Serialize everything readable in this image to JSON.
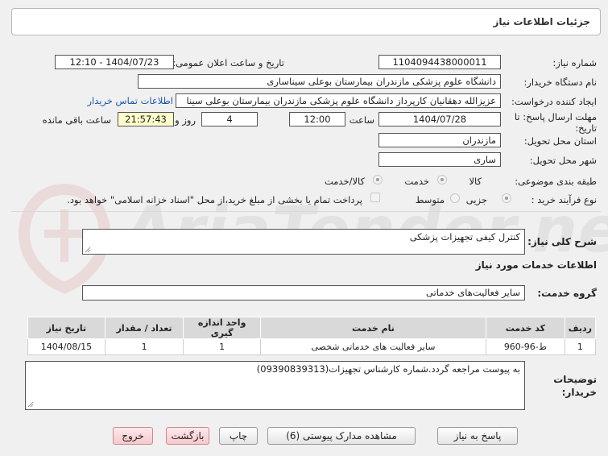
{
  "header": {
    "title": "جزئیات اطلاعات نیاز"
  },
  "fields": {
    "need_number_label": "شماره نیاز:",
    "need_number": "1104094438000011",
    "announce_label": "تاریخ و ساعت اعلان عمومی:",
    "announce_value": "1404/07/23 - 12:10",
    "buyer_org_label": "نام دستگاه خریدار:",
    "buyer_org": "دانشگاه علوم پزشکی مازندران بیمارستان بوعلی سیناساری",
    "requester_label": "ایجاد کننده درخواست:",
    "requester": "عزیزالله دهقانیان کارپرداز دانشگاه علوم پزشکی مازندران بیمارستان بوعلی سینا",
    "contact_link": "اطلاعات تماس خریدار",
    "deadline_label": "مهلت ارسال پاسخ: تا تاریخ:",
    "deadline_date": "1404/07/28",
    "hour_label": "ساعت",
    "deadline_hour": "12:00",
    "days_value": "4",
    "days_label": "روز و",
    "remaining_time": "21:57:43",
    "remaining_label": "ساعت باقی مانده",
    "province_label": "استان محل تحویل:",
    "province": "مازندران",
    "city_label": "شهر محل تحویل:",
    "city": "ساری",
    "category_label": "طبقه بندی موضوعی:",
    "category_options": [
      "کالا",
      "خدمت",
      "کالا/خدمت"
    ],
    "process_label": "نوع فرآیند خرید :",
    "process_options": [
      "جزیی",
      "متوسط"
    ],
    "payment_note": "پرداخت تمام یا بخشی از مبلغ خرید،از محل \"اسناد خزانه اسلامی\" خواهد بود."
  },
  "summary": {
    "label": "شرح کلی نیاز:",
    "value": "کنترل کیفی تجهیزات پزشکی"
  },
  "services": {
    "heading": "اطلاعات خدمات مورد نیاز",
    "group_label": "گروه خدمت:",
    "group_value": "سایر فعالیت‌های خدماتی",
    "columns": [
      "ردیف",
      "کد خدمت",
      "نام خدمت",
      "واحد اندازه گیری",
      "تعداد / مقدار",
      "تاریخ نیاز"
    ],
    "rows": [
      [
        "1",
        "ط-96-960",
        "سایر فعالیت های خدماتی شخصی",
        "1",
        "1",
        "1404/08/15"
      ]
    ]
  },
  "buyer_notes": {
    "label": "توضیحات خریدار:",
    "value": "به پیوست مراجعه گردد.شماره کارشناس تجهیزات(09390839313)"
  },
  "buttons": {
    "reply": "پاسخ به نیاز",
    "attachments": "مشاهده مدارک پیوستی (6)",
    "print": "چاپ",
    "back": "بازگشت",
    "exit": "خروج"
  },
  "colors": {
    "accent_link": "#1a55b0",
    "red_button": "#f6c9ce",
    "timer_bg": "#ffffcc"
  }
}
